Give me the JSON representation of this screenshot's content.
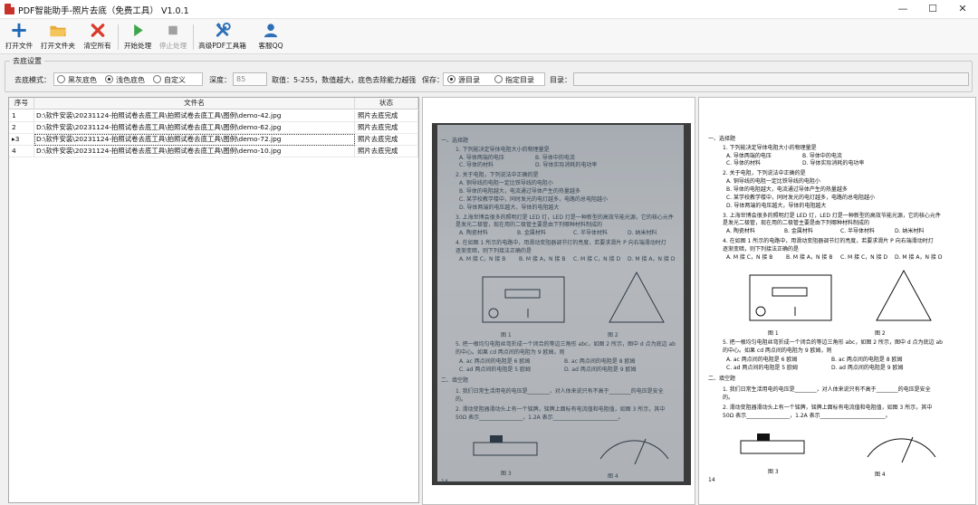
{
  "window": {
    "title": "PDF智能助手-照片去底（免费工具） V1.0.1",
    "min": "—",
    "max": "☐",
    "close": "✕"
  },
  "toolbar": {
    "open_file": "打开文件",
    "open_folder": "打开文件夹",
    "clear_all": "清空所有",
    "start": "开始处理",
    "stop": "停止处理",
    "advanced_pdf": "高级PDF工具箱",
    "support_qq": "客服QQ"
  },
  "settings": {
    "group_title": "去底设置",
    "mode_label": "去底模式：",
    "mode_options": [
      "黑灰底色",
      "浅色底色",
      "自定义"
    ],
    "mode_selected": 1,
    "depth_label": "深度：",
    "depth_value": "85",
    "depth_hint": "取值：5-255，数值越大，底色去除能力越强",
    "save_label": "保存：",
    "save_options": [
      "源目录",
      "指定目录"
    ],
    "save_selected": 0,
    "dir_label": "目录：",
    "dir_value": ""
  },
  "table": {
    "headers": [
      "序号",
      "文件名",
      "状态"
    ],
    "rows": [
      {
        "idx": "1",
        "name": "D:\\软件安装\\20231124-拍照试卷去底工具\\拍照试卷去底工具\\图例\\demo-42.jpg",
        "status": "照片去底完成"
      },
      {
        "idx": "2",
        "name": "D:\\软件安装\\20231124-拍照试卷去底工具\\拍照试卷去底工具\\图例\\demo-62.jpg",
        "status": "照片去底完成"
      },
      {
        "idx": "3",
        "name": "D:\\软件安装\\20231124-拍照试卷去底工具\\拍照试卷去底工具\\图例\\demo-72.jpg",
        "status": "照片去底完成",
        "marker": "▸"
      },
      {
        "idx": "4",
        "name": "D:\\软件安装\\20231124-拍照试卷去底工具\\拍照试卷去底工具\\图例\\demo-10.jpg",
        "status": "照片去底完成"
      }
    ],
    "selected_row": 2
  },
  "document": {
    "lines": [
      "一、选择题",
      "1. 下列能决定导体电阻大小的物理量是",
      "A. 导体两端的电压",
      "B. 导体中的电流",
      "C. 导体的材料",
      "D. 导体实际消耗的电功率",
      "2. 关于电阻，下列说法中正确的是",
      "A. 铜导线的电阻一定比铁导线的电阻小",
      "B. 导体的电阻越大，电流通过导体产生的热量越多",
      "C. 某学校教学楼中，同时发光的电灯越多，电路的总电阻越小",
      "D. 导体两端的电压越大，导体的电阻越大",
      "3. 上海世博会很多的照明灯是 LED 灯，LED 灯是一种新型的高效节能光源，它的核心元件",
      "是发光二极管，现在用的二极管主要是由下列哪种材料制成的",
      "A. 陶瓷材料",
      "B. 金属材料",
      "C. 半导体材料",
      "D. 纳米材料",
      "4. 在如图 1 所示的电路中，用滑动变阻器调节灯的亮度，若要求滑片 P 向右端滑动时灯",
      "逐渐变暗，则下列接法正确的是",
      "A. M 接 C，N 接 B",
      "B. M 接 A，N 接 B",
      "C. M 接 C，N 接 D",
      "D. M 接 A，N 接 D",
      "图 1",
      "图 2",
      "5. 把一根均匀电阻丝弯折成一个闭合的等边三角形 abc，如图 2 所示，图中 d 点为底边 ab",
      "的中心。如果 cd 两点间的电阻为 9 欧姆，则",
      "A. ac 两点间的电阻是 6 欧姆",
      "B. ac 两点间的电阻是 8 欧姆",
      "C. ad 两点间的电阻是 5 欧姆",
      "D. ad 两点间的电阻是 9 欧姆",
      "二、填空题",
      "1. 我们日常生活用电的电压是________，对人体来说只有不高于________的电压是安全",
      "的。",
      "2. 滑动变阻器滑动头上有一个铭牌，铭牌上面标有电流值和电阻值，如图 3 所示，其中",
      "50Ω 表示________________，1.2A 表示________________________。",
      "图 3",
      "图 4",
      "14"
    ]
  },
  "colors": {
    "titlebar": "#ffffff",
    "toolbar": "#f7f7f7",
    "window_bg": "#f0f0f0",
    "add_icon": "#1f67b6",
    "folder_icon": "#e8a93a",
    "close_icon": "#d93b2b",
    "play_icon": "#3ca64a",
    "stop_icon": "#a0a0a0",
    "tools_icon": "#2e6fb7",
    "qq_icon": "#2e6fb7",
    "photo_paper": "#aeb2b6"
  },
  "icons": [
    "plus-icon",
    "folder-icon",
    "close-x-icon",
    "play-icon",
    "stop-icon",
    "tools-icon",
    "user-icon"
  ]
}
